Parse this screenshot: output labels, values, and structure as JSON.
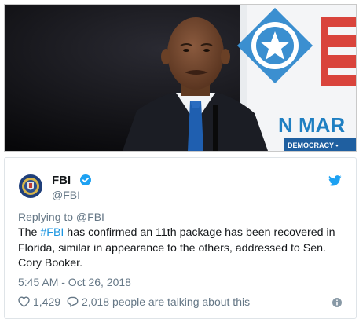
{
  "photo": {
    "banner_word": "N MAR",
    "banner_sub": "DEMOCRACY •",
    "banner_color": "#1f7fc2",
    "accent_red": "#d9443c"
  },
  "tweet": {
    "display_name": "FBI",
    "handle": "@FBI",
    "replying_to": "Replying to @FBI",
    "text_before": "The ",
    "hashtag": "#FBI",
    "text_after": " has confirmed an 11th package has been recovered in Florida, similar in appearance to the others, addressed to Sen. Cory Booker.",
    "timestamp": "5:45 AM - Oct 26, 2018",
    "likes": "1,429",
    "talking": "2,018 people are talking about this",
    "link_color": "#1b95e0"
  },
  "icons": {
    "verified": "verified-badge-icon",
    "bird": "twitter-bird-icon",
    "heart": "heart-icon",
    "reply": "reply-bubble-icon",
    "info": "info-icon"
  }
}
